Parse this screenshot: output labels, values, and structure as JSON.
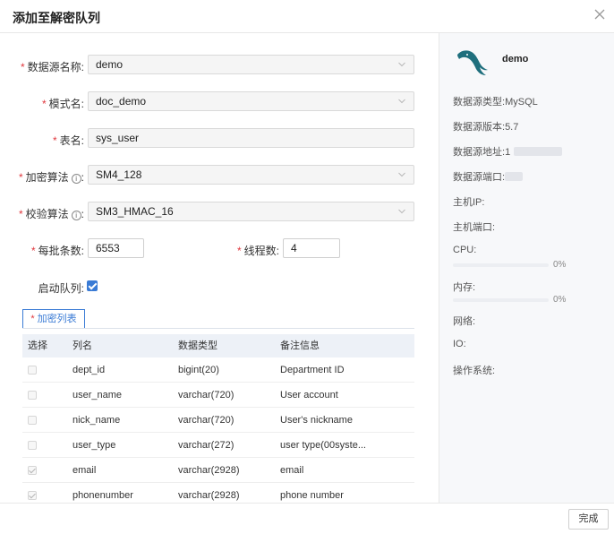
{
  "dialog": {
    "title": "添加至解密队列"
  },
  "form": {
    "datasource_label": "数据源名称:",
    "datasource_value": "demo",
    "schema_label": "模式名:",
    "schema_value": "doc_demo",
    "table_label": "表名:",
    "table_value": "sys_user",
    "encrypt_algo_label": "加密算法",
    "encrypt_algo_value": "SM4_128",
    "verify_algo_label": "校验算法",
    "verify_algo_value": "SM3_HMAC_16",
    "batch_label": "每批条数:",
    "batch_value": "6553",
    "threads_label": "线程数:",
    "threads_value": "4",
    "start_queue_label": "启动队列:",
    "start_queue_checked": true,
    "colon": ":",
    "required_mark": "*",
    "info_mark": "i"
  },
  "tab": {
    "label": "加密列表"
  },
  "table": {
    "headers": [
      "选择",
      "列名",
      "数据类型",
      "备注信息"
    ],
    "rows": [
      {
        "checked": false,
        "name": "dept_id",
        "type": "bigint(20)",
        "comment": "Department ID"
      },
      {
        "checked": false,
        "name": "user_name",
        "type": "varchar(720)",
        "comment": "User account"
      },
      {
        "checked": false,
        "name": "nick_name",
        "type": "varchar(720)",
        "comment": "User's nickname"
      },
      {
        "checked": false,
        "name": "user_type",
        "type": "varchar(272)",
        "comment": "user type(00syste..."
      },
      {
        "checked": true,
        "name": "email",
        "type": "varchar(2928)",
        "comment": "email"
      },
      {
        "checked": true,
        "name": "phonenumber",
        "type": "varchar(2928)",
        "comment": "phone number"
      }
    ]
  },
  "footer": {
    "done_label": "完成"
  },
  "sidebar": {
    "name": "demo",
    "logo_icon": "mysql-dolphin-icon",
    "type_label": "数据源类型:",
    "type_value": "MySQL",
    "version_label": "数据源版本:",
    "version_value": "5.7",
    "address_label": "数据源地址:",
    "address_value": "1",
    "port_label": "数据源端口:",
    "host_ip_label": "主机IP:",
    "host_port_label": "主机端口:",
    "cpu_label": "CPU:",
    "cpu_percent": "0%",
    "cpu_fraction": 0,
    "memory_label": "内存:",
    "memory_percent": "0%",
    "memory_fraction": 0,
    "network_label": "网络:",
    "io_label": "IO:",
    "os_label": "操作系统:"
  },
  "colors": {
    "accent": "#3a7bd5",
    "required": "#e0383e",
    "logo": "#1f6f7d"
  }
}
